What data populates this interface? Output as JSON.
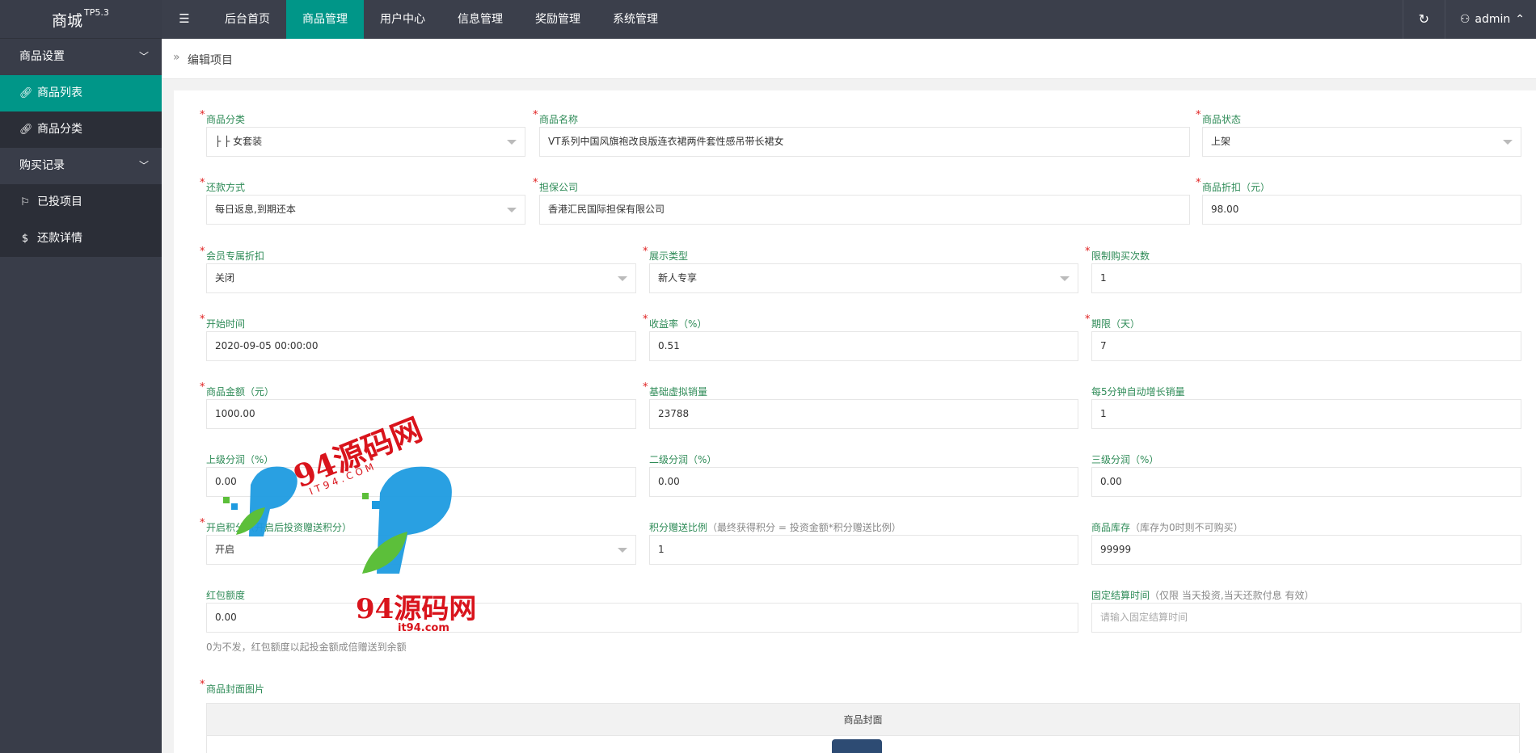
{
  "brand": {
    "name": "商城",
    "version": "TP5.3"
  },
  "nav": [
    {
      "label": "后台首页",
      "active": false
    },
    {
      "label": "商品管理",
      "active": true
    },
    {
      "label": "用户中心",
      "active": false
    },
    {
      "label": "信息管理",
      "active": false
    },
    {
      "label": "奖励管理",
      "active": false
    },
    {
      "label": "系统管理",
      "active": false
    }
  ],
  "user": {
    "name": "admin"
  },
  "sidebar": {
    "group1": "商品设置",
    "item1": "商品列表",
    "item2": "商品分类",
    "group2": "购买记录",
    "item3": "已投项目",
    "item4": "还款详情"
  },
  "breadcrumb": "编辑项目",
  "form": {
    "category": {
      "label": "商品分类",
      "value": "├ ├ 女套装"
    },
    "name": {
      "label": "商品名称",
      "value": "VT系列中国风旗袍改良版连衣裙两件套性感吊带长裙女"
    },
    "status": {
      "label": "商品状态",
      "value": "上架"
    },
    "repay": {
      "label": "还款方式",
      "value": "每日返息,到期还本"
    },
    "guarantor": {
      "label": "担保公司",
      "value": "香港汇民国际担保有限公司"
    },
    "discount": {
      "label": "商品折扣（元）",
      "value": "98.00"
    },
    "member_discount": {
      "label": "会员专属折扣",
      "value": "关闭"
    },
    "display_type": {
      "label": "展示类型",
      "value": "新人专享"
    },
    "buy_limit": {
      "label": "限制购买次数",
      "value": "1"
    },
    "start_time": {
      "label": "开始时间",
      "value": "2020-09-05 00:00:00"
    },
    "yield": {
      "label": "收益率（%）",
      "value": "0.51"
    },
    "period": {
      "label": "期限（天）",
      "value": "7"
    },
    "amount": {
      "label": "商品金额（元）",
      "value": "1000.00"
    },
    "base_sales": {
      "label": "基础虚拟销量",
      "value": "23788"
    },
    "auto_sales": {
      "label": "每5分钟自动增长销量",
      "value": "1"
    },
    "level1": {
      "label": "上级分润（%）",
      "value": "0.00"
    },
    "level2": {
      "label": "二级分润（%）",
      "value": "0.00"
    },
    "level3": {
      "label": "三级分润（%）",
      "value": "0.00"
    },
    "points": {
      "label": "开启积分（开启后投资赠送积分）",
      "value": "开启"
    },
    "points_ratio": {
      "label": "积分赠送比例",
      "hint": "（最终获得积分 = 投资金额*积分赠送比例）",
      "value": "1"
    },
    "stock": {
      "label": "商品库存",
      "hint": "（库存为0时则不可购买）",
      "value": "99999"
    },
    "redpack": {
      "label": "红包额度",
      "value": "0.00",
      "help": "0为不发，红包额度以起投金额成倍赠送到余额"
    },
    "settle_time": {
      "label": "固定结算时间",
      "hint": "（仅限 当天投资,当天还款付息 有效）",
      "placeholder": "请输入固定结算时间"
    },
    "cover": {
      "label": "商品封面图片",
      "column": "商品封面"
    }
  },
  "watermark": {
    "text": "94源码网",
    "url": "it94.com",
    "sub": "I T 9 4 . C O M"
  },
  "colors": {
    "accent": "#009688",
    "topbar": "#3b3f4b",
    "sidebar": "#393d49"
  }
}
